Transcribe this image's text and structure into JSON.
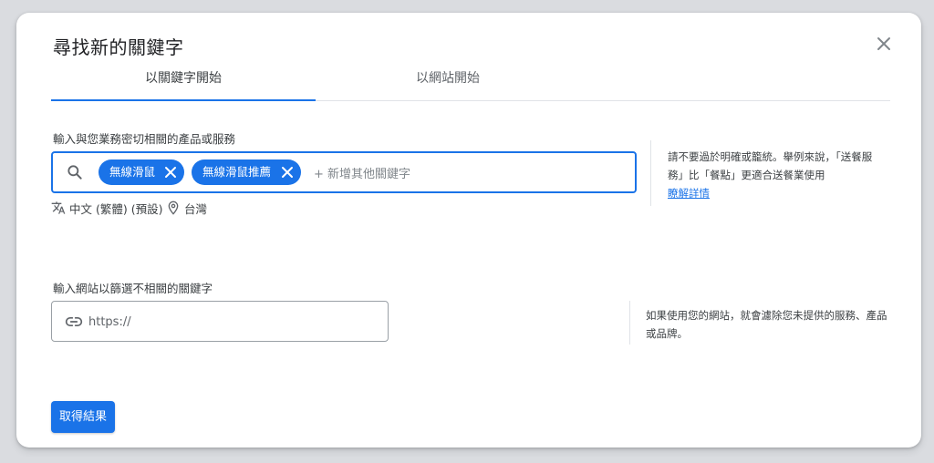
{
  "dialog": {
    "title": "尋找新的關鍵字",
    "close_icon": "close-icon"
  },
  "tabs": [
    {
      "label": "以關鍵字開始",
      "active": true
    },
    {
      "label": "以網站開始",
      "active": false
    }
  ],
  "keywords": {
    "label": "輸入與您業務密切相關的產品或服務",
    "chips": [
      "無線滑鼠",
      "無線滑鼠推薦"
    ],
    "add_placeholder": "+ 新增其他關鍵字",
    "language": "中文 (繁體) (預設)",
    "location": "台灣",
    "hint": "請不要過於明確或籠統。舉例來說，「送餐服務」比「餐點」更適合送餐業使用",
    "learn_more": "瞭解詳情"
  },
  "website": {
    "label": "輸入網站以篩選不相關的關鍵字",
    "placeholder": "https://",
    "value": "",
    "hint": "如果使用您的網站，就會濾除您未提供的服務、產品或品牌。"
  },
  "submit_label": "取得結果",
  "colors": {
    "accent": "#1a73e8",
    "backdrop": "#dadce0",
    "surface": "#ffffff"
  }
}
